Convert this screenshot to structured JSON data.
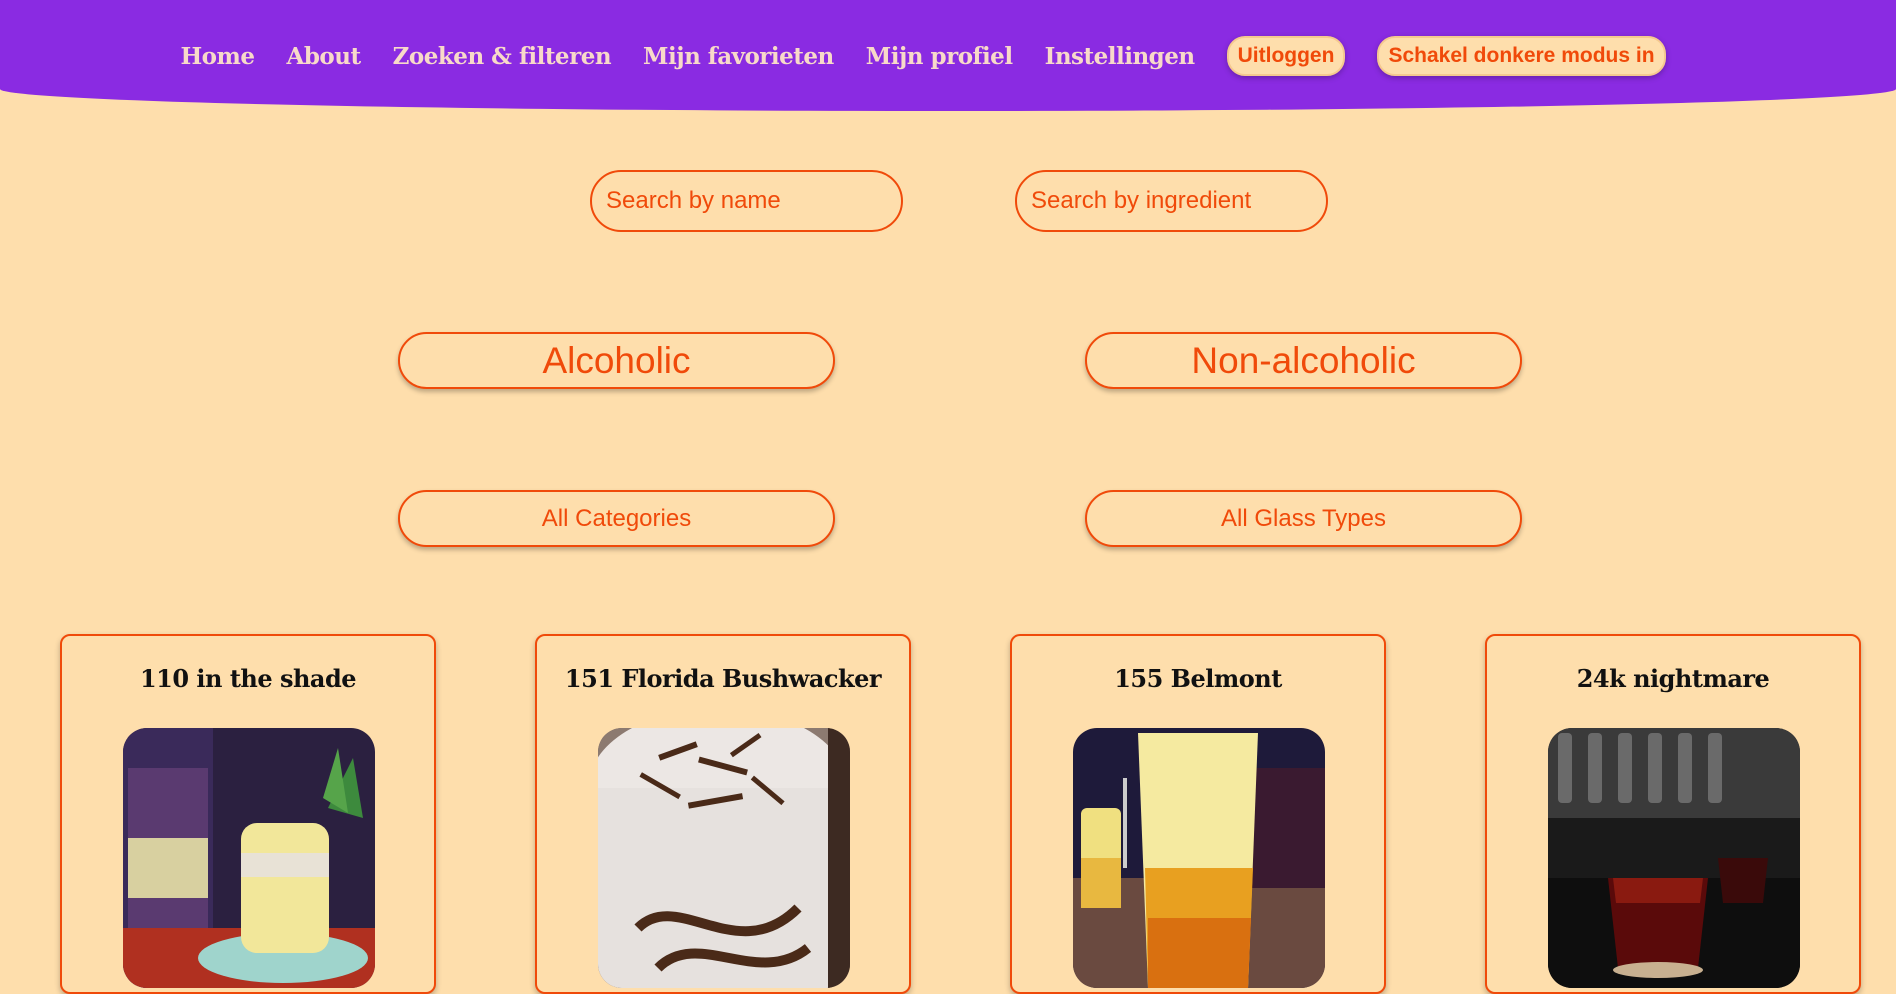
{
  "nav": {
    "links": [
      "Home",
      "About",
      "Zoeken & filteren",
      "Mijn favorieten",
      "Mijn profiel",
      "Instellingen"
    ],
    "logout_label": "Uitloggen",
    "dark_mode_label": "Schakel donkere modus in"
  },
  "search": {
    "name_placeholder": "Search by name",
    "ingredient_placeholder": "Search by ingredient"
  },
  "filters": {
    "alcoholic_label": "Alcoholic",
    "non_alcoholic_label": "Non-alcoholic",
    "category_label": "All Categories",
    "glass_label": "All Glass Types"
  },
  "cards": [
    {
      "title": "110 in the shade",
      "image": "cocktail-photo"
    },
    {
      "title": "151 Florida Bushwacker",
      "image": "cocktail-photo"
    },
    {
      "title": "155 Belmont",
      "image": "cocktail-photo"
    },
    {
      "title": "24k nightmare",
      "image": "cocktail-photo"
    }
  ],
  "colors": {
    "header": "#8A2BE2",
    "background": "#FEDEAC",
    "accent": "#F04A0A",
    "nav_text": "#F8D9C9"
  }
}
